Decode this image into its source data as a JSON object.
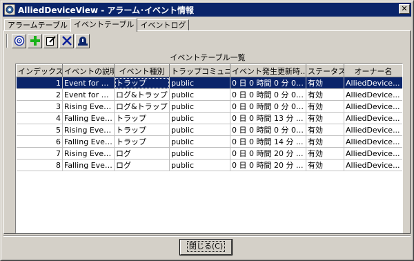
{
  "window": {
    "title": "AlliedDeviceView - アラーム･イベント情報",
    "close_symbol": "✕"
  },
  "tabs": [
    {
      "label": "アラームテーブル",
      "active": false
    },
    {
      "label": "イベントテーブル",
      "active": true
    },
    {
      "label": "イベントログ",
      "active": false
    }
  ],
  "toolbar": {
    "buttons": [
      {
        "icon": "refresh-icon"
      },
      {
        "icon": "add-icon"
      },
      {
        "icon": "edit-icon"
      },
      {
        "icon": "delete-icon"
      },
      {
        "icon": "alarm-bell-icon"
      }
    ]
  },
  "list_title": "イベントテーブル一覧",
  "table": {
    "columns": [
      "インデックス",
      "イベントの説明",
      "イベント種別",
      "トラップコミュニテ…",
      "イベント発生更新時…",
      "ステータス",
      "オーナー名"
    ],
    "rows": [
      [
        "1",
        "Event for Al...",
        "トラップ",
        "public",
        "0 日 0 時間 0 分 0 ...",
        "有効",
        "AlliedDevice..."
      ],
      [
        "2",
        "Event for Al...",
        "ログ&トラップ",
        "public",
        "0 日 0 時間 0 分 0 ...",
        "有効",
        "AlliedDevice..."
      ],
      [
        "3",
        "Rising Event...",
        "ログ&トラップ",
        "public",
        "0 日 0 時間 0 分 0 ...",
        "有効",
        "AlliedDevice..."
      ],
      [
        "4",
        "Falling Even...",
        "トラップ",
        "public",
        "0 日 0 時間 13 分 ...",
        "有効",
        "AlliedDevice..."
      ],
      [
        "5",
        "Rising Event...",
        "トラップ",
        "public",
        "0 日 0 時間 0 分 0 ...",
        "有効",
        "AlliedDevice..."
      ],
      [
        "6",
        "Falling Even...",
        "トラップ",
        "public",
        "0 日 0 時間 14 分 ...",
        "有効",
        "AlliedDevice..."
      ],
      [
        "7",
        "Rising Event...",
        "ログ",
        "public",
        "0 日 0 時間 20 分 ...",
        "有効",
        "AlliedDevice..."
      ],
      [
        "8",
        "Falling Even...",
        "ログ",
        "public",
        "0 日 0 時間 20 分 ...",
        "有効",
        "AlliedDevice..."
      ]
    ],
    "selected_row": 0
  },
  "footer": {
    "close_button": "閉じる(C)"
  },
  "colors": {
    "titlebar": "#0a246a",
    "selection": "#0a246a",
    "face": "#d4d0c8"
  }
}
